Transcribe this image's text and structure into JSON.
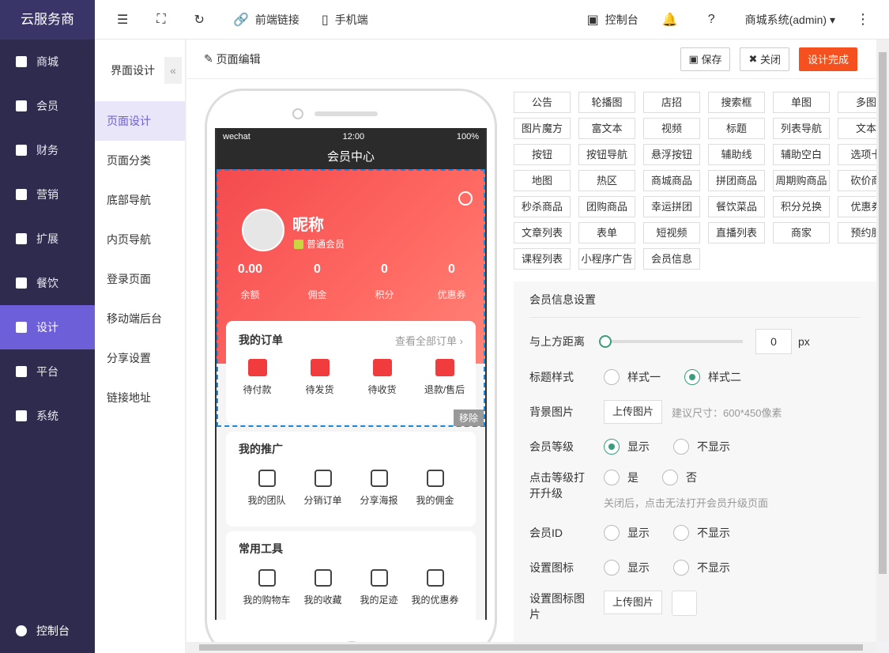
{
  "sidebar": {
    "brand": "云服务商",
    "items": [
      {
        "label": "商城"
      },
      {
        "label": "会员"
      },
      {
        "label": "财务"
      },
      {
        "label": "营销"
      },
      {
        "label": "扩展"
      },
      {
        "label": "餐饮"
      },
      {
        "label": "设计"
      },
      {
        "label": "平台"
      },
      {
        "label": "系统"
      }
    ],
    "bottom": "控制台"
  },
  "topbar": {
    "frontend_link": "前端链接",
    "mobile": "手机端",
    "console": "控制台",
    "user": "商城系统(admin)"
  },
  "subnav": {
    "title": "界面设计",
    "items": [
      {
        "label": "页面设计"
      },
      {
        "label": "页面分类"
      },
      {
        "label": "底部导航"
      },
      {
        "label": "内页导航"
      },
      {
        "label": "登录页面"
      },
      {
        "label": "移动端后台"
      },
      {
        "label": "分享设置"
      },
      {
        "label": "链接地址"
      }
    ]
  },
  "editor": {
    "title": "页面编辑",
    "save": "保存",
    "close": "关闭",
    "done": "设计完成"
  },
  "phone": {
    "carrier": "wechat",
    "time": "12:00",
    "battery": "100%",
    "page_title": "会员中心",
    "nickname": "昵称",
    "level": "普通会员",
    "stats": [
      {
        "value": "0.00",
        "label": "余额"
      },
      {
        "value": "0",
        "label": "佣金"
      },
      {
        "value": "0",
        "label": "积分"
      },
      {
        "value": "0",
        "label": "优惠券"
      }
    ],
    "orders_title": "我的订单",
    "orders_all": "查看全部订单 ›",
    "orders": [
      {
        "label": "待付款"
      },
      {
        "label": "待发货"
      },
      {
        "label": "待收货"
      },
      {
        "label": "退款/售后"
      }
    ],
    "remove": "移除",
    "promo_title": "我的推广",
    "promo": [
      {
        "label": "我的团队"
      },
      {
        "label": "分销订单"
      },
      {
        "label": "分享海报"
      },
      {
        "label": "我的佣金"
      }
    ],
    "tools_title": "常用工具",
    "tools": [
      {
        "label": "我的购物车"
      },
      {
        "label": "我的收藏"
      },
      {
        "label": "我的足迹"
      },
      {
        "label": "我的优惠券"
      }
    ]
  },
  "components": [
    [
      "公告",
      "轮播图",
      "店招",
      "搜索框",
      "单图",
      "多图"
    ],
    [
      "图片魔方",
      "富文本",
      "视频",
      "标题",
      "列表导航",
      "文本"
    ],
    [
      "按钮",
      "按钮导航",
      "悬浮按钮",
      "辅助线",
      "辅助空白",
      "选项卡"
    ],
    [
      "地图",
      "热区",
      "商城商品",
      "拼团商品",
      "周期购商品",
      "砍价商"
    ],
    [
      "秒杀商品",
      "团购商品",
      "幸运拼团",
      "餐饮菜品",
      "积分兑换",
      "优惠券"
    ],
    [
      "文章列表",
      "表单",
      "短视频",
      "直播列表",
      "商家",
      "预约服"
    ],
    [
      "课程列表",
      "小程序广告",
      "会员信息"
    ]
  ],
  "settings": {
    "title": "会员信息设置",
    "distance_label": "与上方距离",
    "distance_value": "0",
    "distance_unit": "px",
    "title_style_label": "标题样式",
    "style1": "样式一",
    "style2": "样式二",
    "bg_label": "背景图片",
    "upload": "上传图片",
    "bg_hint": "建议尺寸：600*450像素",
    "level_label": "会员等级",
    "show": "显示",
    "hide": "不显示",
    "click_level_label": "点击等级打开升级",
    "yes": "是",
    "no": "否",
    "click_hint": "关闭后，点击无法打开会员升级页面",
    "id_label": "会员ID",
    "set_icon_label": "设置图标",
    "set_icon_img_label": "设置图标图片"
  }
}
